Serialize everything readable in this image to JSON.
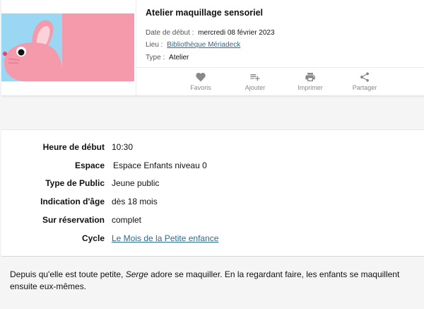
{
  "event": {
    "title": "Atelier maquillage sensoriel",
    "date_label": "Date de début :",
    "date_value": "mercredi 08 février 2023",
    "lieu_label": "Lieu :",
    "lieu_value": "Bibliothèque Mériadeck",
    "type_label": "Type :",
    "type_value": "Atelier"
  },
  "actions": [
    {
      "label": "Favoris",
      "icon": "heart-icon"
    },
    {
      "label": "Ajouter",
      "icon": "playlist-add-icon"
    },
    {
      "label": "Imprimer",
      "icon": "printer-icon"
    },
    {
      "label": "Partager",
      "icon": "share-icon"
    }
  ],
  "details": [
    {
      "label": "Heure de début",
      "value": "10:30"
    },
    {
      "label": "Espace",
      "value": "Espace Enfants niveau 0"
    },
    {
      "label": "Type de Public",
      "value": "Jeune public"
    },
    {
      "label": "Indication d'âge",
      "value": "dès 18 mois"
    },
    {
      "label": "Sur réservation",
      "value": "complet"
    },
    {
      "label": "Cycle",
      "value": "Le Mois de la Petite enfance"
    }
  ],
  "description": {
    "before": "Depuis qu'elle est toute petite, ",
    "emph": "Serge",
    "after": " adore se maquiller. En la regardant faire, les enfants se maquillent ensuite eux-mêmes."
  },
  "colors": {
    "link": "#2b6c8f",
    "thumb_pink": "#f49aab",
    "thumb_sky": "#9ad7f3"
  }
}
